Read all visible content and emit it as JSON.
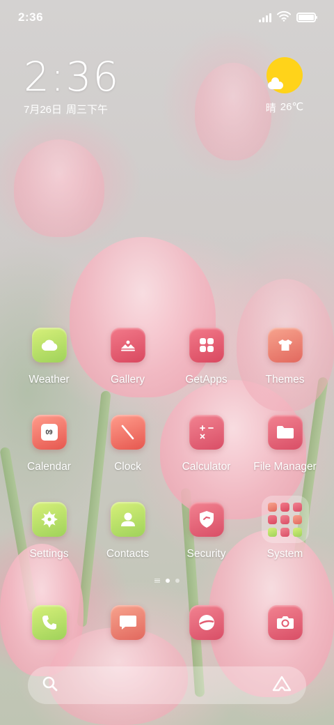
{
  "status_bar": {
    "time": "2:36"
  },
  "clock_widget": {
    "time": "2:36",
    "date": "7月26日",
    "weekday": "周三下午"
  },
  "weather_widget": {
    "condition": "晴",
    "temperature": "26℃",
    "icon": "sun-cloud-icon"
  },
  "apps": [
    {
      "label": "Weather",
      "icon": "cloud-icon",
      "color": "#b4e064"
    },
    {
      "label": "Gallery",
      "icon": "mountain-image-icon",
      "color": "#e25a6f"
    },
    {
      "label": "GetApps",
      "icon": "grid-four-icon",
      "color": "#e25a6f"
    },
    {
      "label": "Themes",
      "icon": "tshirt-icon",
      "color": "#ee7d6a"
    },
    {
      "label": "Calendar",
      "icon": "calendar-icon",
      "color": "#ee7d6a",
      "day": "09"
    },
    {
      "label": "Clock",
      "icon": "clock-hand-icon",
      "color": "#ee7d6a"
    },
    {
      "label": "Calculator",
      "icon": "calculator-icon",
      "color": "#e25a6f"
    },
    {
      "label": "File Manager",
      "icon": "folder-icon",
      "color": "#e25a6f"
    },
    {
      "label": "Settings",
      "icon": "gear-icon",
      "color": "#b4e064"
    },
    {
      "label": "Contacts",
      "icon": "person-icon",
      "color": "#b4e064"
    },
    {
      "label": "Security",
      "icon": "shield-icon",
      "color": "#e25a6f"
    }
  ],
  "folder": {
    "label": "System"
  },
  "dock": [
    {
      "icon": "phone-icon",
      "color": "#b4e064"
    },
    {
      "icon": "message-icon",
      "color": "#ee7d6a"
    },
    {
      "icon": "browser-icon",
      "color": "#e25a6f"
    },
    {
      "icon": "camera-icon",
      "color": "#e25a6f"
    }
  ],
  "search_bar": {
    "left_icon": "search-icon",
    "right_icon": "assistant-icon"
  },
  "page_indicator": {
    "current_page": 1,
    "total_pages": 2
  }
}
